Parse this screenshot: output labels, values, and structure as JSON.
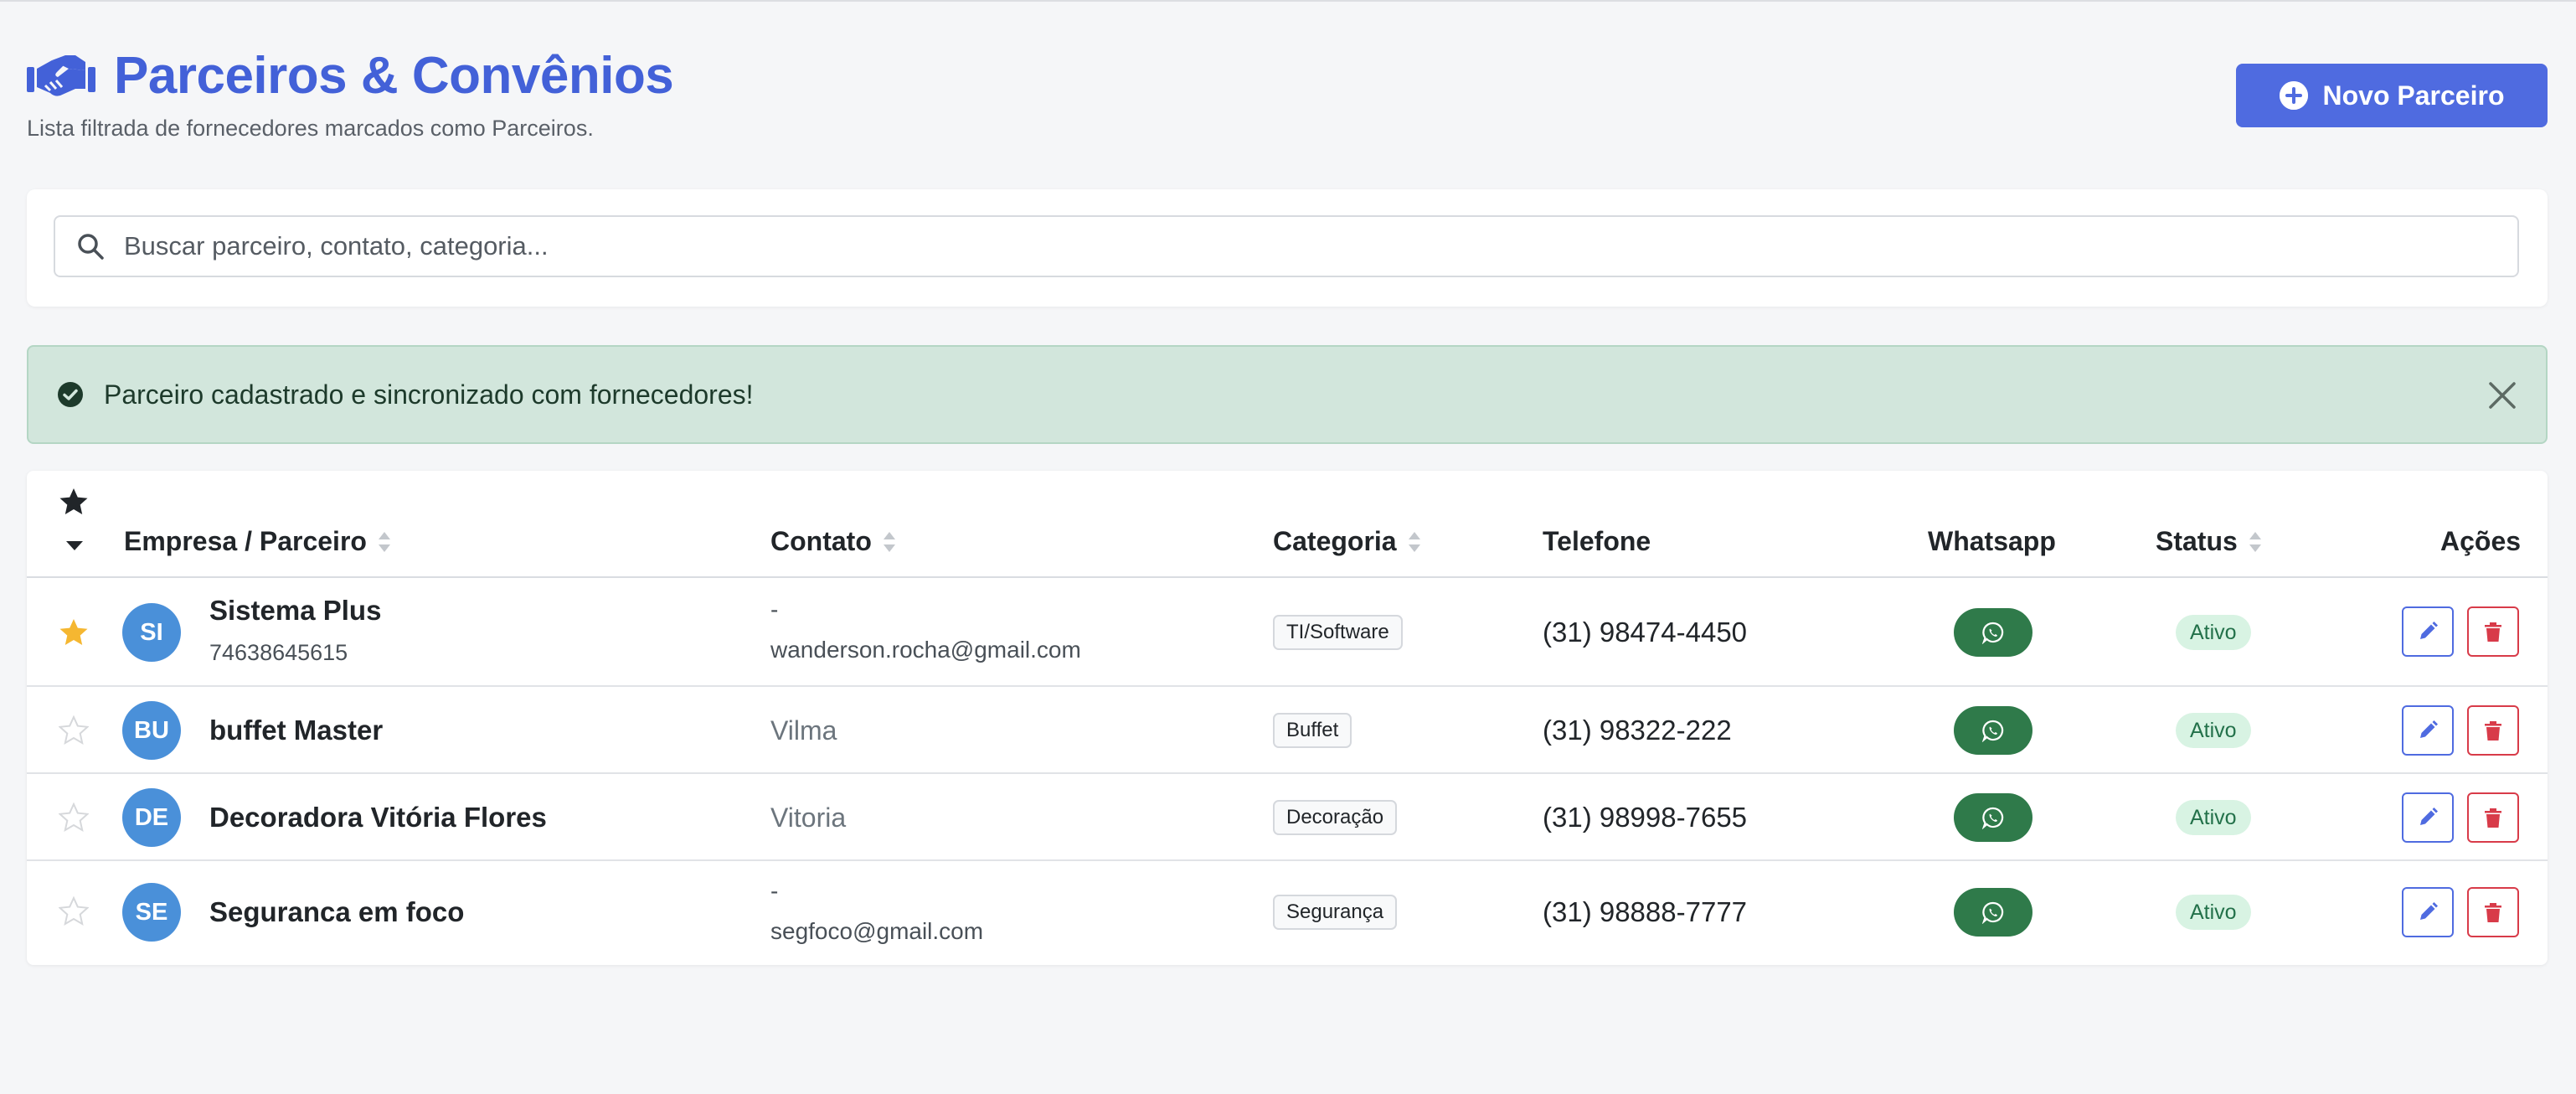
{
  "header": {
    "title": "Parceiros & Convênios",
    "subtitle": "Lista filtrada de fornecedores marcados como Parceiros.",
    "new_button_label": "Novo Parceiro",
    "icon": "handshake-icon"
  },
  "search": {
    "placeholder": "Buscar parceiro, contato, categoria...",
    "value": ""
  },
  "alert": {
    "type": "success",
    "message": "Parceiro cadastrado e sincronizado com fornecedores!"
  },
  "table": {
    "columns": {
      "company": "Empresa / Parceiro",
      "contact": "Contato",
      "category": "Categoria",
      "phone": "Telefone",
      "whatsapp": "Whatsapp",
      "status": "Status",
      "actions": "Ações"
    },
    "rows": [
      {
        "favorite": true,
        "initials": "SI",
        "name": "Sistema Plus",
        "document": "74638645615",
        "contact_name": "-",
        "contact_email": "wanderson.rocha@gmail.com",
        "category": "TI/Software",
        "phone": "(31) 98474-4450",
        "status": "Ativo"
      },
      {
        "favorite": false,
        "initials": "BU",
        "name": "buffet Master",
        "document": "",
        "contact_name": "Vilma",
        "contact_email": "",
        "category": "Buffet",
        "phone": "(31) 98322-222",
        "status": "Ativo"
      },
      {
        "favorite": false,
        "initials": "DE",
        "name": "Decoradora Vitória Flores",
        "document": "",
        "contact_name": "Vitoria",
        "contact_email": "",
        "category": "Decoração",
        "phone": "(31) 98998-7655",
        "status": "Ativo"
      },
      {
        "favorite": false,
        "initials": "SE",
        "name": "Seguranca em foco",
        "document": "",
        "contact_name": "-",
        "contact_email": "segfoco@gmail.com",
        "category": "Segurança",
        "phone": "(31) 98888-7777",
        "status": "Ativo"
      }
    ]
  },
  "colors": {
    "primary": "#4f6be0",
    "title": "#4361d8",
    "success_bg": "#d2e6dc",
    "whatsapp": "#2f7a4a",
    "danger": "#d83b49",
    "star_active": "#f5b731",
    "avatar": "#4a90d9"
  }
}
